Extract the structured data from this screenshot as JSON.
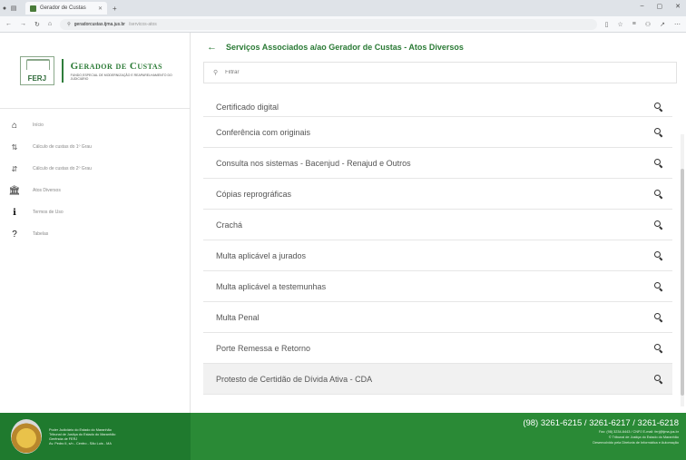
{
  "browser": {
    "tab_title": "Gerador de Custas",
    "url_host": "geradorcustas.tjma.jus.br",
    "url_path": "/servicos-atos"
  },
  "sidebar": {
    "logo_title": "Gerador de Custas",
    "logo_seal_text": "FERJ",
    "logo_subtitle": "FUNDO ESPECIAL DE MODERNIZAÇÃO E REAPARELHAMENTO DO JUDICIÁRIO",
    "items": [
      {
        "label": "Início",
        "icon": "home-icon"
      },
      {
        "label": "Cálculo de custas do 1º Grau",
        "icon": "sort-one-icon"
      },
      {
        "label": "Cálculo de custas do 2º Grau",
        "icon": "sort-two-icon"
      },
      {
        "label": "Atos Diversos",
        "icon": "bank-icon"
      },
      {
        "label": "Termos de Uso",
        "icon": "info-icon"
      },
      {
        "label": "Tabelas",
        "icon": "help-icon"
      }
    ]
  },
  "main": {
    "title": "Serviços Associados a/ao Gerador de Custas - Atos Diversos",
    "search_placeholder": "Filtrar",
    "items": [
      "Certificado digital",
      "Conferência com originais",
      "Consulta nos sistemas - Bacenjud - Renajud e Outros",
      "Cópias reprográficas",
      "Crachá",
      "Multa aplicável a jurados",
      "Multa aplicável a testemunhas",
      "Multa Penal",
      "Porte Remessa e Retorno",
      "Protesto de Certidão de Dívida Ativa - CDA"
    ]
  },
  "footer": {
    "org_line1": "Poder Judiciário do Estado do Maranhão",
    "org_line2": "Tribunal de Justiça do Estado do Maranhão",
    "org_line3": "Gerência de FERJ",
    "org_line4": "Av. Pedro II, s/n - Centro - São Luís - MA",
    "phones": "(98) 3261-6215 / 3261-6217 / 3261-6218",
    "contact_line": "Fax: (98) 3234-6443 / CNPJ E-mail: ferj@tjma.jus.br",
    "court_line": "© Tribunal de Justiça do Estado do Maranhão",
    "dev_line": "Desenvolvido pela Diretoria de Informática e Automação"
  },
  "colors": {
    "brand_green": "#2a7a35",
    "footer_dark": "#1f7a2e",
    "footer_light": "#2a8a36"
  }
}
